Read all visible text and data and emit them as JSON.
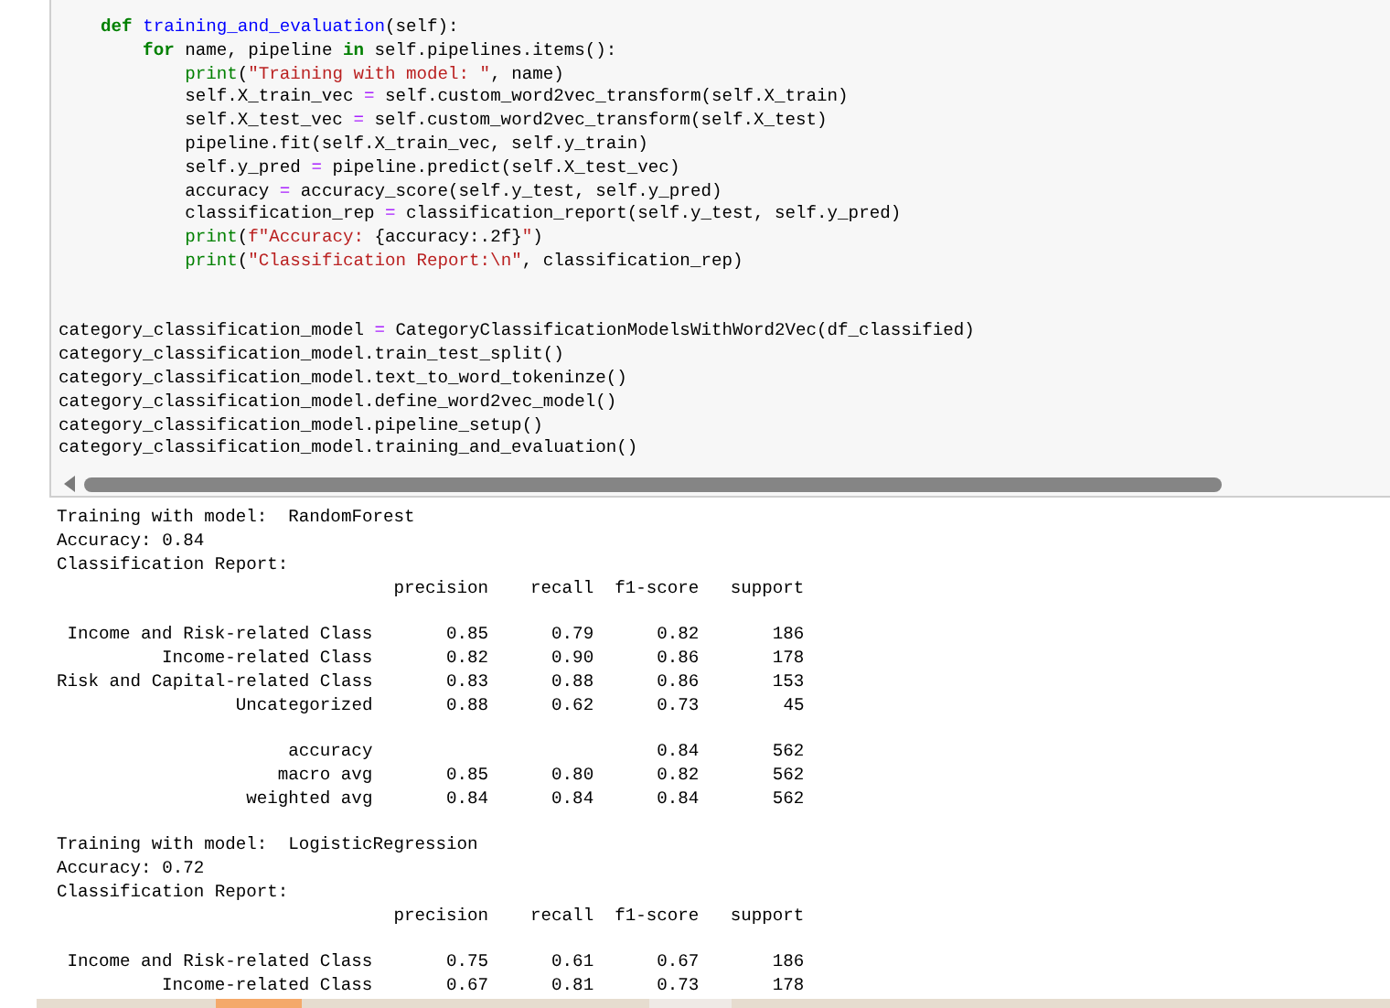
{
  "code_cell": {
    "lines": [
      {
        "kind": "code",
        "tokens": [
          {
            "text": "    def",
            "kind": "keyword"
          },
          {
            "text": " training_and_evaluation",
            "kind": "function"
          },
          {
            "text": "(self):",
            "kind": "plain"
          }
        ]
      },
      {
        "kind": "code",
        "tokens": [
          {
            "text": "        for",
            "kind": "keyword"
          },
          {
            "text": " name, pipeline ",
            "kind": "plain"
          },
          {
            "text": "in",
            "kind": "keyword"
          },
          {
            "text": " self.pipelines.items():",
            "kind": "plain"
          }
        ]
      },
      {
        "kind": "code",
        "tokens": [
          {
            "text": "            print",
            "kind": "builtin"
          },
          {
            "text": "(",
            "kind": "plain"
          },
          {
            "text": "\"Training with model: \"",
            "kind": "string"
          },
          {
            "text": ", name)",
            "kind": "plain"
          }
        ]
      },
      {
        "kind": "code",
        "tokens": [
          {
            "text": "            self.X_train_vec ",
            "kind": "plain"
          },
          {
            "text": "=",
            "kind": "operator"
          },
          {
            "text": " self.custom_word2vec_transform(self.X_train)",
            "kind": "plain"
          }
        ]
      },
      {
        "kind": "code",
        "tokens": [
          {
            "text": "            self.X_test_vec ",
            "kind": "plain"
          },
          {
            "text": "=",
            "kind": "operator"
          },
          {
            "text": " self.custom_word2vec_transform(self.X_test)",
            "kind": "plain"
          }
        ]
      },
      {
        "kind": "code",
        "tokens": [
          {
            "text": "            pipeline.fit(self.X_train_vec, self.y_train)",
            "kind": "plain"
          }
        ]
      },
      {
        "kind": "code",
        "tokens": [
          {
            "text": "            self.y_pred ",
            "kind": "plain"
          },
          {
            "text": "=",
            "kind": "operator"
          },
          {
            "text": " pipeline.predict(self.X_test_vec)",
            "kind": "plain"
          }
        ]
      },
      {
        "kind": "code",
        "tokens": [
          {
            "text": "            accuracy ",
            "kind": "plain"
          },
          {
            "text": "=",
            "kind": "operator"
          },
          {
            "text": " accuracy_score(self.y_test, self.y_pred)",
            "kind": "plain"
          }
        ]
      },
      {
        "kind": "code",
        "tokens": [
          {
            "text": "            classification_rep ",
            "kind": "plain"
          },
          {
            "text": "=",
            "kind": "operator"
          },
          {
            "text": " classification_report(self.y_test, self.y_pred)",
            "kind": "plain"
          }
        ]
      },
      {
        "kind": "code",
        "tokens": [
          {
            "text": "            print",
            "kind": "builtin"
          },
          {
            "text": "(",
            "kind": "plain"
          },
          {
            "text": "f\"Accuracy: ",
            "kind": "string"
          },
          {
            "text": "{accuracy:.2f}",
            "kind": "plain"
          },
          {
            "text": "\"",
            "kind": "string"
          },
          {
            "text": ")",
            "kind": "plain"
          }
        ]
      },
      {
        "kind": "code",
        "tokens": [
          {
            "text": "            print",
            "kind": "builtin"
          },
          {
            "text": "(",
            "kind": "plain"
          },
          {
            "text": "\"Classification Report:\\n\"",
            "kind": "string"
          },
          {
            "text": ", classification_rep)",
            "kind": "plain"
          }
        ]
      },
      {
        "kind": "blank"
      },
      {
        "kind": "blank"
      },
      {
        "kind": "code",
        "tokens": [
          {
            "text": "category_classification_model ",
            "kind": "plain"
          },
          {
            "text": "=",
            "kind": "operator"
          },
          {
            "text": " CategoryClassificationModelsWithWord2Vec(df_classified)",
            "kind": "plain"
          }
        ]
      },
      {
        "kind": "code",
        "tokens": [
          {
            "text": "category_classification_model.train_test_split()",
            "kind": "plain"
          }
        ]
      },
      {
        "kind": "code",
        "tokens": [
          {
            "text": "category_classification_model.text_to_word_tokeninze()",
            "kind": "plain"
          }
        ]
      },
      {
        "kind": "code",
        "tokens": [
          {
            "text": "category_classification_model.define_word2vec_model()",
            "kind": "plain"
          }
        ]
      },
      {
        "kind": "code",
        "tokens": [
          {
            "text": "category_classification_model.pipeline_setup()",
            "kind": "plain"
          }
        ]
      },
      {
        "kind": "code",
        "tokens": [
          {
            "text": "category_classification_model.training_and_evaluation()",
            "kind": "plain"
          }
        ]
      }
    ]
  },
  "output": [
    {
      "training_line": "Training with model:  RandomForest",
      "accuracy_line": "Accuracy: 0.84",
      "report_title": "Classification Report:",
      "header": [
        "precision",
        "recall",
        "f1-score",
        "support"
      ],
      "class_rows": [
        {
          "label": "Income and Risk-related Class",
          "cells": [
            "0.85",
            "0.79",
            "0.82",
            "186"
          ]
        },
        {
          "label": "Income-related Class",
          "cells": [
            "0.82",
            "0.90",
            "0.86",
            "178"
          ]
        },
        {
          "label": "Risk and Capital-related Class",
          "cells": [
            "0.83",
            "0.88",
            "0.86",
            "153"
          ]
        },
        {
          "label": "Uncategorized",
          "cells": [
            "0.88",
            "0.62",
            "0.73",
            "45"
          ]
        }
      ],
      "summary_rows": [
        {
          "label": "accuracy",
          "cells": [
            null,
            null,
            "0.84",
            "562"
          ]
        },
        {
          "label": "macro avg",
          "cells": [
            "0.85",
            "0.80",
            "0.82",
            "562"
          ]
        },
        {
          "label": "weighted avg",
          "cells": [
            "0.84",
            "0.84",
            "0.84",
            "562"
          ]
        }
      ]
    },
    {
      "training_line": "Training with model:  LogisticRegression",
      "accuracy_line": "Accuracy: 0.72",
      "report_title": "Classification Report:",
      "header": [
        "precision",
        "recall",
        "f1-score",
        "support"
      ],
      "class_rows": [
        {
          "label": "Income and Risk-related Class",
          "cells": [
            "0.75",
            "0.61",
            "0.67",
            "186"
          ]
        },
        {
          "label": "Income-related Class",
          "cells": [
            "0.67",
            "0.81",
            "0.73",
            "178"
          ]
        }
      ]
    }
  ]
}
